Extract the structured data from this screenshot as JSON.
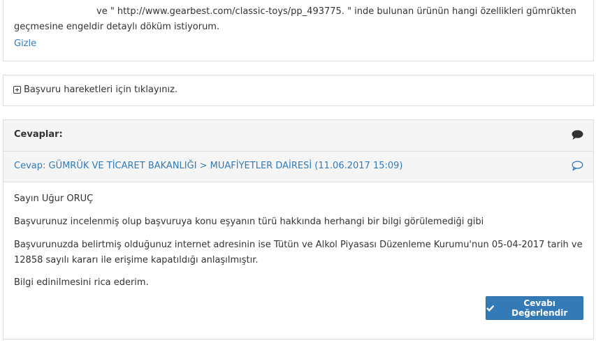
{
  "question": {
    "text_line1": "ve \" http://www.gearbest.com/classic-toys/pp_493775. \" inde bulunan ürünün hangi özellikleri gümrükten",
    "text_line2": "geçmesine engeldir detaylı döküm istiyorum.",
    "hide_link": "Gizle"
  },
  "history": {
    "label": "Başvuru hareketleri için tıklayınız."
  },
  "answers": {
    "header": "Cevaplar:",
    "reply_title": "Cevap: GÜMRÜK VE TİCARET BAKANLIĞI > MUAFİYETLER DAİRESİ (11.06.2017 15:09)",
    "greeting": "Sayın Uğur ORUÇ",
    "paragraph1": "Başvurunuz incelenmiş olup başvuruya konu eşyanın türü hakkında herhangi bir bilgi görülemediği gibi",
    "paragraph2": "Başvurunuzda belirtmiş olduğunuz internet adresinin ise Tütün ve Alkol Piyasası Düzenleme Kurumu'nun 05-04-2017 tarih ve 12858 sayılı kararı ile erişime kapatıldığı anlaşılmıştır.",
    "paragraph3": "Bilgi edinilmesini rica ederim.",
    "rate_button": "Cevabı Değerlendir"
  },
  "icons": {
    "expand": "plus-square-icon",
    "comments": "comments-icon",
    "comment": "comment-outline-icon",
    "check": "check-icon"
  },
  "colors": {
    "link": "#337ab7",
    "button_bg": "#337ab7",
    "panel_heading_bg": "#f5f5f5",
    "border": "#dddddd"
  }
}
